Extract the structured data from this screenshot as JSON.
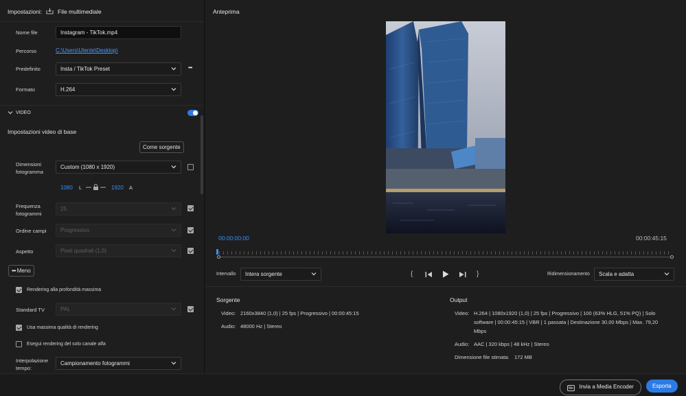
{
  "left": {
    "header": {
      "title": "Impostazioni:",
      "tab": "File multimediale"
    },
    "filename": {
      "label": "Nome file",
      "value": "Instagram - TikTok.mp4"
    },
    "path": {
      "label": "Percorso",
      "value": "C:\\Users\\Utente\\Desktop\\"
    },
    "preset": {
      "label": "Predefinito",
      "value": "Insta / TikTok Preset",
      "more": "•••"
    },
    "format": {
      "label": "Formato",
      "value": "H.264"
    },
    "video_section": {
      "label": "VIDEO",
      "enabled": true
    },
    "basic": {
      "heading": "Impostazioni video di base",
      "match_source": "Come sorgente",
      "frame_size": {
        "label1": "Dimensioni",
        "label2": "fotogramma",
        "value": "Custom (1080 x 1920)",
        "checked": false
      },
      "width": "1080",
      "width_unit": "L",
      "height": "1920",
      "height_unit": "A",
      "frame_rate": {
        "label1": "Frequenza",
        "label2": "fotogrammi",
        "value": "25",
        "checked": true
      },
      "field_order": {
        "label": "Ordine campi",
        "value": "Progressivo",
        "checked": true
      },
      "aspect": {
        "label": "Aspetto",
        "value": "Pixel quadrati (1,0)",
        "checked": true
      },
      "less": "Meno",
      "max_depth": {
        "label": "Rendering alla profondità massima",
        "checked": true
      },
      "tv_standard": {
        "label": "Standard TV",
        "value": "PAL",
        "checked": true
      },
      "max_quality": {
        "label": "Usa massima qualità di rendering",
        "checked": true
      },
      "alpha_only": {
        "label": "Esegui rendering del solo canale alfa",
        "checked": false
      },
      "time_interp": {
        "label1": "Interpolazione",
        "label2": "tempo:",
        "value": "Campionamento fotogrammi"
      }
    }
  },
  "right": {
    "title": "Anteprima",
    "timecode_start": "00:00:00:00",
    "timecode_end": "00:00:45:15",
    "range": {
      "label": "Intervallo",
      "value": "Intera sorgente"
    },
    "scaling": {
      "label": "Ridimensionamento",
      "value": "Scala e adatta"
    },
    "controls": {
      "in": "{",
      "out": "}"
    },
    "source": {
      "heading": "Sorgente",
      "video_label": "Video:",
      "video_value": "2160x3840 (1,0)  |  25 fps  |  Progressivo  |  00:00:45:15",
      "audio_label": "Audio:",
      "audio_value": "48000 Hz  |  Stereo"
    },
    "output": {
      "heading": "Output",
      "video_label": "Video:",
      "video_line1": "H.264  |  1080x1920 (1,0)  |  25 fps  |  Progressivo  |  100 (63% HLG, 51% PQ)  |  Solo",
      "video_line2": "software  |  00:00:45:15  |  VBR  |  1 passata  |  Destinazione 30,00 Mbps  |  Max. 79,20",
      "video_line3": "Mbps",
      "audio_label": "Audio:",
      "audio_value": "AAC  |  320 kbps  |  48 kHz  |  Stereo",
      "size_label": "Dimensione file stimata:",
      "size_value": "172 MB"
    }
  },
  "footer": {
    "send_badge": "Me",
    "send_label": "Invia a Media Encoder",
    "export_label": "Esporta"
  },
  "colors": {
    "accent": "#2c7be5",
    "link": "#4d9bff",
    "bg": "#1e1e1e"
  }
}
